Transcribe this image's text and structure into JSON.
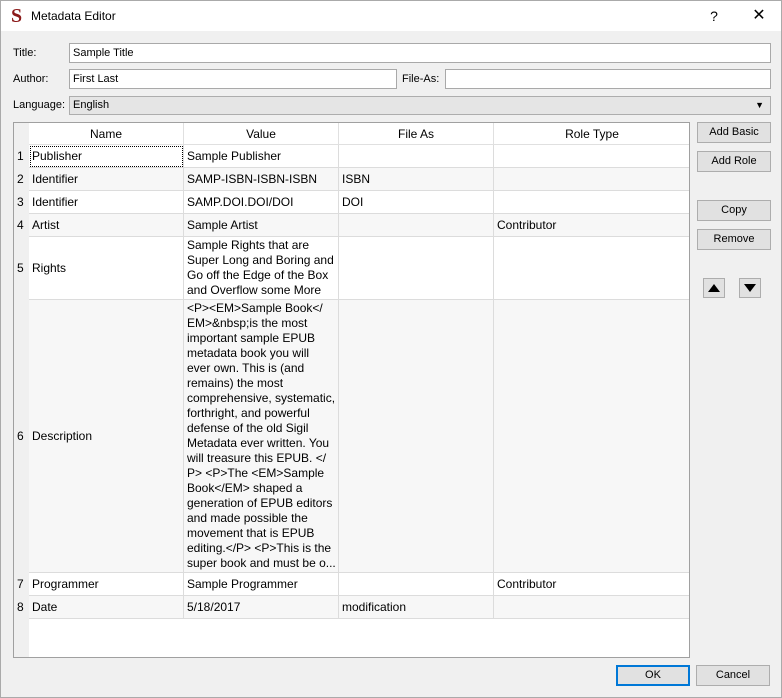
{
  "window": {
    "title": "Metadata Editor",
    "help": "?",
    "close": "✕"
  },
  "fields": {
    "title_label": "Title:",
    "title_value": "Sample Title",
    "author_label": "Author:",
    "author_value": "First Last",
    "file_as_label": "File-As:",
    "file_as_value": "",
    "language_label": "Language:",
    "language_value": "English"
  },
  "table": {
    "headers": [
      "Name",
      "Value",
      "File As",
      "Role Type"
    ],
    "rows": [
      {
        "num": "1",
        "name": "Publisher",
        "value": "Sample Publisher",
        "file_as": "",
        "role": ""
      },
      {
        "num": "2",
        "name": "Identifier",
        "value": "SAMP-ISBN-ISBN-ISBN",
        "file_as": "ISBN",
        "role": ""
      },
      {
        "num": "3",
        "name": "Identifier",
        "value": "SAMP.DOI.DOI/DOI",
        "file_as": "DOI",
        "role": ""
      },
      {
        "num": "4",
        "name": "Artist",
        "value": "Sample Artist",
        "file_as": "",
        "role": "Contributor"
      },
      {
        "num": "5",
        "name": "Rights",
        "value": [
          "Sample Rights that are",
          "Super Long and Boring and",
          "Go off the Edge of the Box",
          "and Overflow some More"
        ],
        "file_as": "",
        "role": ""
      },
      {
        "num": "6",
        "name": "Description",
        "value": [
          "<P><EM>Sample Book</",
          "EM>&nbsp;is the most",
          "important sample EPUB",
          "metadata book you will",
          "ever own. This is (and",
          "remains) the most",
          "comprehensive, systematic,",
          "forthright, and powerful",
          "defense of the old Sigil",
          "Metadata ever written. You",
          "will treasure this EPUB. </",
          "P> <P>The <EM>Sample",
          "Book</EM> shaped a",
          "generation of EPUB editors",
          "and made possible the",
          "movement that is EPUB",
          "editing.</P> <P>This is the",
          "super book and must be o..."
        ],
        "file_as": "",
        "role": ""
      },
      {
        "num": "7",
        "name": "Programmer",
        "value": "Sample Programmer",
        "file_as": "",
        "role": "Contributor"
      },
      {
        "num": "8",
        "name": "Date",
        "value": "5/18/2017",
        "file_as": "modification",
        "role": ""
      }
    ]
  },
  "buttons": {
    "add_basic": "Add Basic",
    "add_role": "Add Role",
    "copy": "Copy",
    "remove": "Remove",
    "ok": "OK",
    "cancel": "Cancel"
  },
  "icons": {
    "app": "sigil-logo",
    "move_up": "triangle-up-icon",
    "move_down": "triangle-down-icon"
  }
}
